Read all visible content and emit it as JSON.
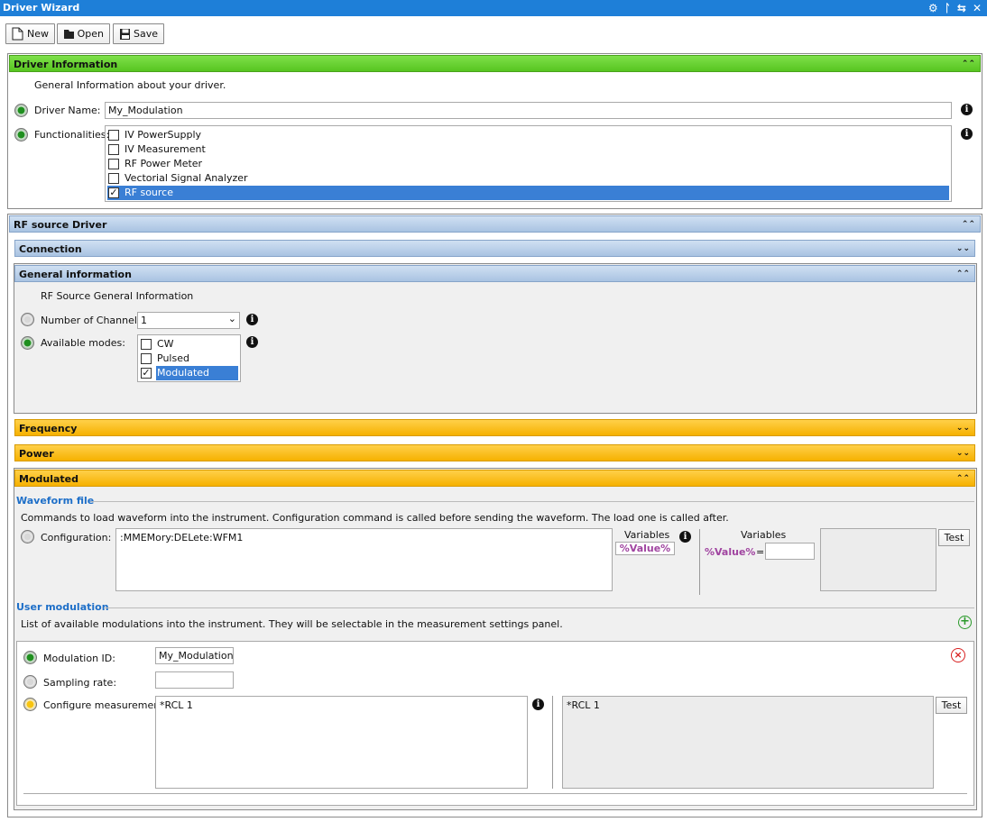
{
  "window": {
    "title": "Driver Wizard"
  },
  "toolbar": {
    "new_label": "New",
    "open_label": "Open",
    "save_label": "Save"
  },
  "driver_info": {
    "header": "Driver Information",
    "description": "General Information about your driver.",
    "name_label": "Driver Name:",
    "name_value": "My_Modulation",
    "func_label": "Functionalities:",
    "functionalities": [
      {
        "label": "IV PowerSupply",
        "checked": false
      },
      {
        "label": "IV Measurement",
        "checked": false
      },
      {
        "label": "RF Power Meter",
        "checked": false
      },
      {
        "label": "Vectorial Signal Analyzer",
        "checked": false
      },
      {
        "label": "RF source",
        "checked": true
      }
    ]
  },
  "rf_driver": {
    "header": "RF source Driver",
    "connection_header": "Connection",
    "general_header": "General information",
    "general_desc": "RF Source General Information",
    "channels_label": "Number of Channels:",
    "channels_value": "1",
    "modes_label": "Available modes:",
    "modes": [
      {
        "label": "CW",
        "checked": false
      },
      {
        "label": "Pulsed",
        "checked": false
      },
      {
        "label": "Modulated",
        "checked": true
      }
    ],
    "frequency_header": "Frequency",
    "power_header": "Power",
    "modulated_header": "Modulated",
    "waveform_title": "Waveform file",
    "waveform_desc": "Commands to load waveform into the instrument. Configuration command is called before sending the waveform. The load one is called after.",
    "config_label": "Configuration:",
    "config_value": ":MMEMory:DELete:WFM1",
    "variables_label": "Variables",
    "variable_token": "%Value%",
    "variables_label2": "Variables",
    "variable_token2": "%Value%",
    "equals": "=",
    "test_label": "Test",
    "user_mod_title": "User modulation",
    "user_mod_desc": "List of available modulations into the instrument. They will be selectable in the measurement settings panel.",
    "mod_id_label": "Modulation ID:",
    "mod_id_value": "My_Modulation",
    "sampling_label": "Sampling rate:",
    "sampling_value": "",
    "configure_label": "Configure measurement:",
    "configure_value": "*RCL 1",
    "configure_preview": "*RCL 1",
    "test_label2": "Test"
  },
  "colors": {
    "title_bar": "#1e7fd8",
    "driver_header": "#6fd83a",
    "blue_header": "#b8cfe9",
    "orange_header": "#f8bb10",
    "selection": "#3a7fd5",
    "section_title": "#1e6fc8"
  }
}
